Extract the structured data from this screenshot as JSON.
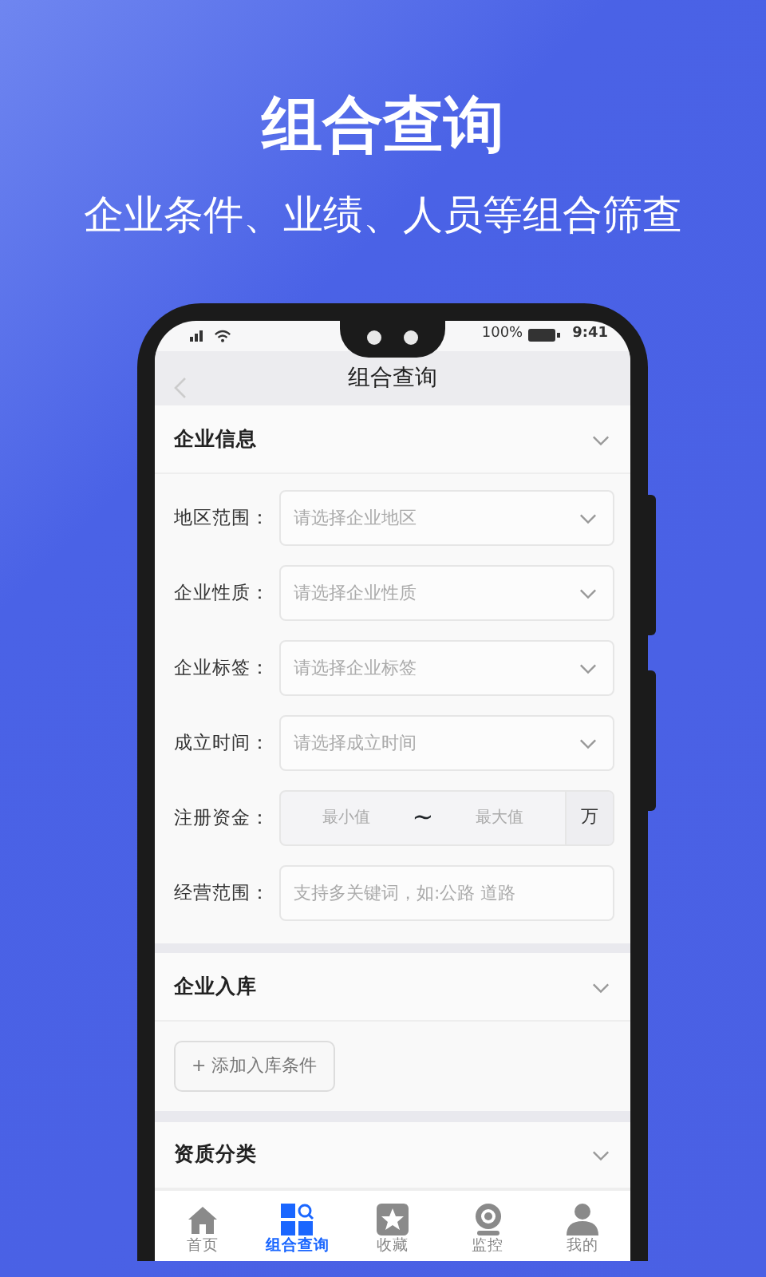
{
  "headline": "组合查询",
  "subtitle": "企业条件、业绩、人员等组合筛查",
  "phone": {
    "status_bar": {
      "battery": "100%",
      "time": "9:41"
    },
    "nav_title": "组合查询",
    "sections": [
      {
        "title": "企业信息",
        "kind": "form",
        "fields": [
          {
            "kind": "select",
            "label": "地区范围：",
            "placeholder": "请选择企业地区"
          },
          {
            "kind": "select",
            "label": "企业性质：",
            "placeholder": "请选择企业性质"
          },
          {
            "kind": "select",
            "label": "企业标签：",
            "placeholder": "请选择企业标签"
          },
          {
            "kind": "select",
            "label": "成立时间：",
            "placeholder": "请选择成立时间"
          },
          {
            "kind": "range",
            "label": "注册资金：",
            "min_placeholder": "最小值",
            "separator": "~",
            "max_placeholder": "最大值",
            "unit": "万"
          },
          {
            "kind": "text",
            "label": "经营范围：",
            "placeholder": "支持多关键词，如:公路 道路"
          }
        ]
      },
      {
        "title": "企业入库",
        "kind": "action",
        "button": "+ 添加入库条件"
      },
      {
        "title": "资质分类",
        "kind": "header"
      }
    ],
    "tabs": [
      {
        "label": "首页",
        "selected": false
      },
      {
        "label": "组合查询",
        "selected": true
      },
      {
        "label": "收藏",
        "selected": false
      },
      {
        "label": "监控",
        "selected": false
      },
      {
        "label": "我的",
        "selected": false
      }
    ]
  }
}
